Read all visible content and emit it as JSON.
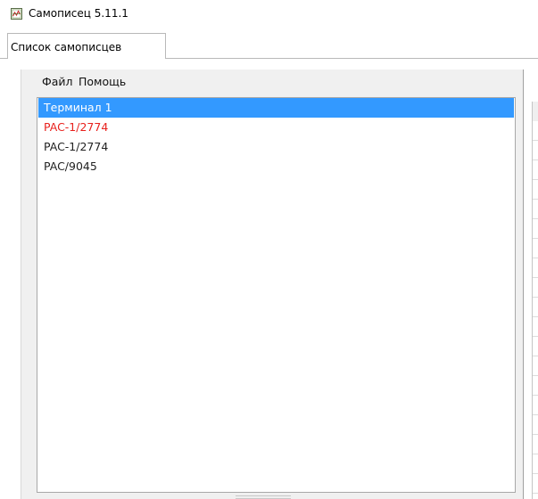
{
  "window": {
    "title": "Самописец 5.11.1"
  },
  "tabs": [
    {
      "label": "Список самописцев",
      "active": true
    }
  ],
  "menu": {
    "file": "Файл",
    "help": "Помощь"
  },
  "recorders": [
    {
      "label": "Терминал 1",
      "selected": true,
      "color": "#ffffff"
    },
    {
      "label": "PAC-1/2774",
      "selected": false,
      "color": "#e8211d"
    },
    {
      "label": "PAC-1/2774",
      "selected": false,
      "color": "#222222"
    },
    {
      "label": "PAC/9045",
      "selected": false,
      "color": "#222222"
    }
  ],
  "colors": {
    "selection": "#3399ff",
    "error_text": "#e8211d"
  }
}
